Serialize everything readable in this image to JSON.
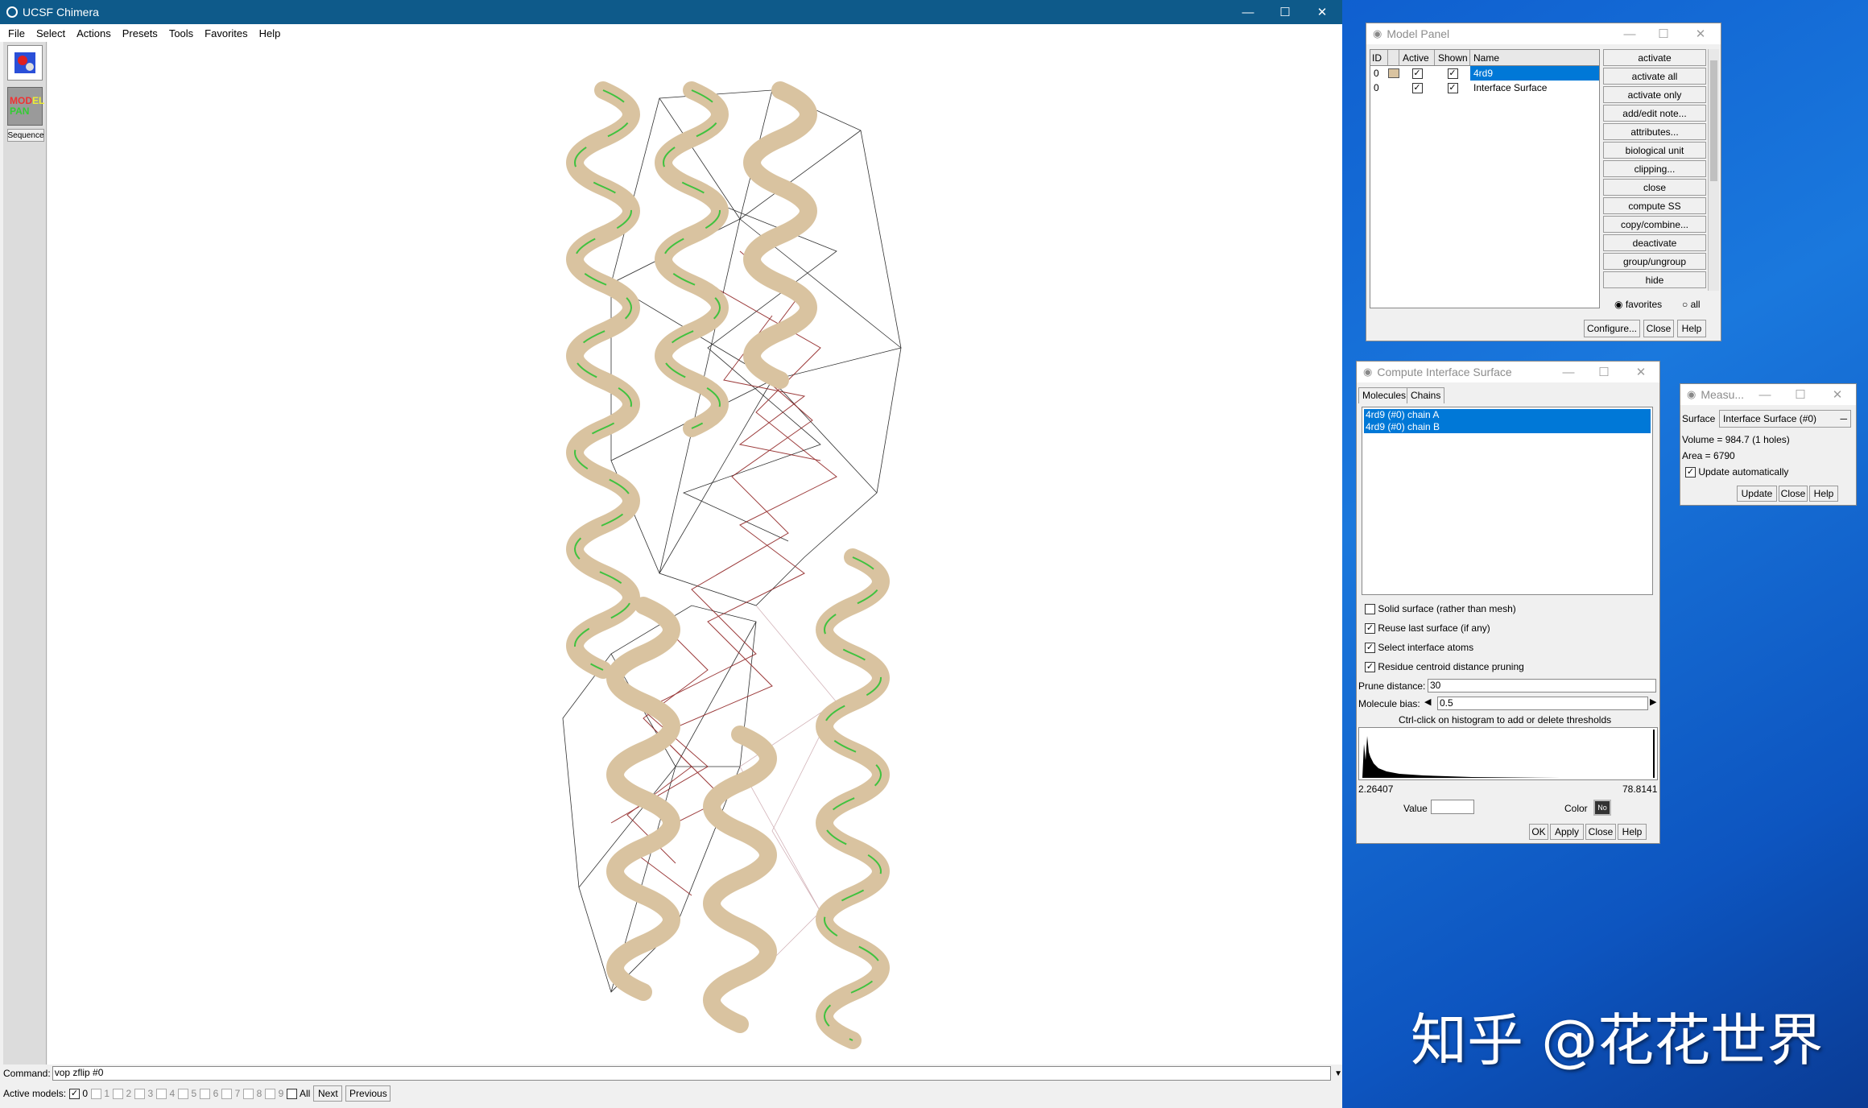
{
  "chimera": {
    "title": "UCSF Chimera",
    "menu": [
      "File",
      "Select",
      "Actions",
      "Presets",
      "Tools",
      "Favorites",
      "Help"
    ],
    "toolbar": {
      "model_panel_icon": "MOD EL PAN",
      "sequence": "Sequence"
    },
    "command_label": "Command:",
    "command_value": "vop zflip #0",
    "active_models_label": "Active models:",
    "models": [
      "0",
      "1",
      "2",
      "3",
      "4",
      "5",
      "6",
      "7",
      "8",
      "9"
    ],
    "all_label": "All",
    "next_label": "Next",
    "previous_label": "Previous"
  },
  "model_panel": {
    "title": "Model Panel",
    "columns": [
      "ID",
      "",
      "Active",
      "Shown",
      "Name"
    ],
    "rows": [
      {
        "id": "0",
        "name": "4rd9"
      },
      {
        "id": "0",
        "name": "Interface Surface"
      }
    ],
    "buttons": [
      "activate",
      "activate all",
      "activate only",
      "add/edit note...",
      "attributes...",
      "biological unit",
      "clipping...",
      "close",
      "compute SS",
      "copy/combine...",
      "deactivate",
      "group/ungroup",
      "hide"
    ],
    "radio_favorites": "favorites",
    "radio_all": "all",
    "configure": "Configure...",
    "close": "Close",
    "help": "Help"
  },
  "interface": {
    "title": "Compute Interface Surface",
    "tab_molecules": "Molecules",
    "tab_chains": "Chains",
    "chains": [
      "4rd9 (#0) chain A",
      "4rd9 (#0) chain B"
    ],
    "opt_solid": "Solid surface (rather than mesh)",
    "opt_reuse": "Reuse last surface (if any)",
    "opt_select": "Select interface atoms",
    "opt_prune": "Residue centroid distance pruning",
    "prune_label": "Prune distance:",
    "prune_value": "30",
    "bias_label": "Molecule bias:",
    "bias_value": "0.5",
    "hist_hint": "Ctrl-click on histogram to add or delete thresholds",
    "hist_min": "2.26407",
    "hist_max": "78.8141",
    "value_label": "Value",
    "color_label": "Color",
    "color_value": "No",
    "ok": "OK",
    "apply": "Apply",
    "close": "Close",
    "help": "Help"
  },
  "measure": {
    "title": "Measu...",
    "surface_label": "Surface",
    "surface_value": "Interface Surface (#0)",
    "volume": "Volume =  984.7 (1 holes)",
    "area": "Area =  6790",
    "auto": "Update automatically",
    "update": "Update",
    "close": "Close",
    "help": "Help"
  },
  "watermark": "知乎 @花花世界",
  "colors": {
    "selection": "#0078d7",
    "ribbon": "#d9c3a0",
    "green": "#3fc23f",
    "mesh_red": "#8b1a1a",
    "desktop": "#1560c8"
  }
}
